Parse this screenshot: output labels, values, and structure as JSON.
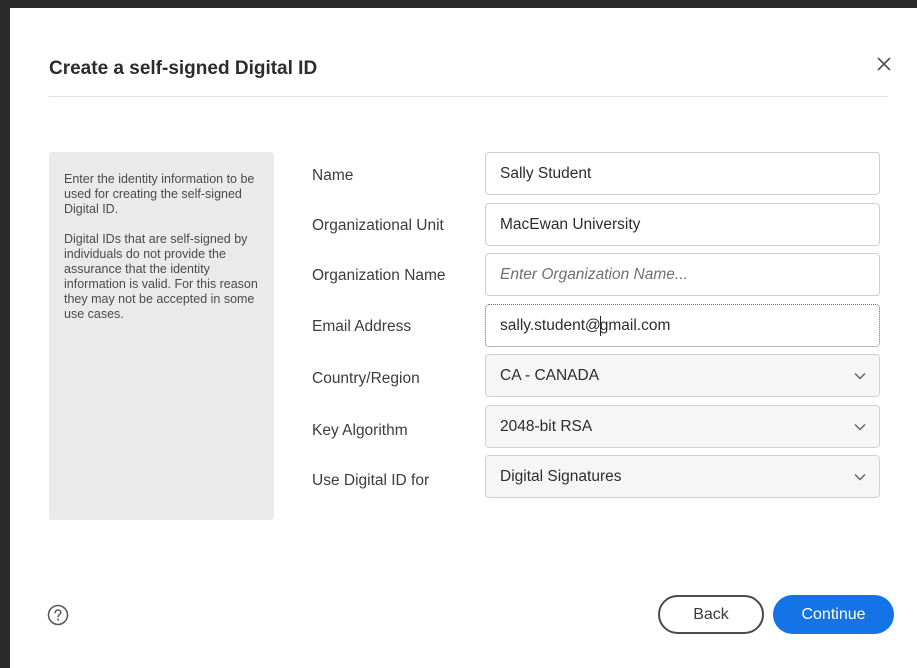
{
  "dialog": {
    "title": "Create a self-signed Digital ID",
    "close_icon": "close-icon"
  },
  "info": {
    "paragraph1": "Enter the identity information to be used for creating the self-signed Digital ID.",
    "paragraph2": "Digital IDs that are self-signed by individuals do not provide the assurance that the identity information is valid. For this reason they may not be accepted in some use cases."
  },
  "form": {
    "name": {
      "label": "Name",
      "value": "Sally Student"
    },
    "org_unit": {
      "label": "Organizational Unit",
      "value": "MacEwan University"
    },
    "org_name": {
      "label": "Organization Name",
      "value": "",
      "placeholder": "Enter Organization Name..."
    },
    "email": {
      "label": "Email Address",
      "value_before_caret": "sally.student@",
      "value_after_caret": "gmail.com"
    },
    "country": {
      "label": "Country/Region",
      "value": "CA - CANADA"
    },
    "key_algorithm": {
      "label": "Key Algorithm",
      "value": "2048-bit RSA"
    },
    "use_for": {
      "label": "Use Digital ID for",
      "value": "Digital Signatures"
    }
  },
  "footer": {
    "help_icon": "help-circle-icon",
    "back_label": "Back",
    "continue_label": "Continue"
  },
  "colors": {
    "primary": "#1473e6",
    "panel_bg": "#eaeaea",
    "backdrop": "#2b2b2b"
  }
}
